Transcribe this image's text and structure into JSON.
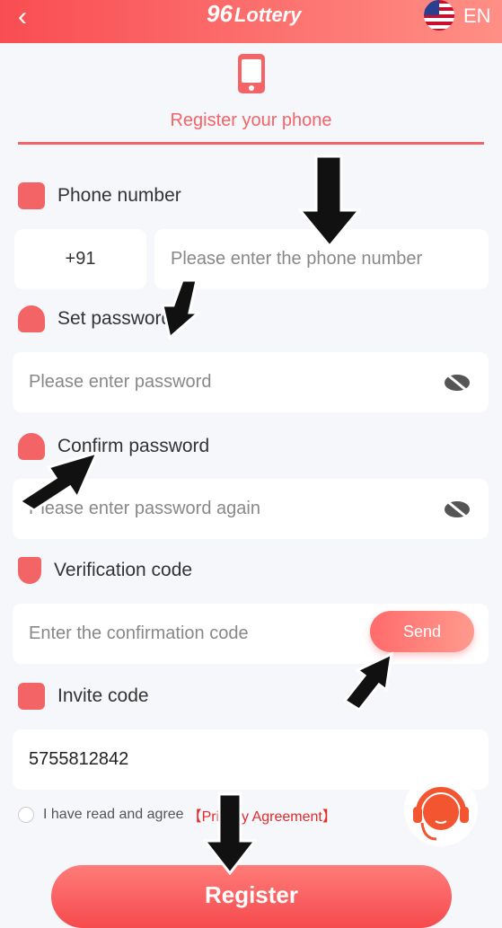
{
  "header": {
    "back_icon": "chevron-left-icon",
    "logo_text": "Lottery",
    "logo_mark": "96",
    "language": "EN",
    "flag_icon": "us-flag-icon"
  },
  "tab": {
    "title": "Register your phone",
    "icon": "smartphone-icon"
  },
  "form": {
    "phone": {
      "label": "Phone number",
      "country_code": "+91",
      "placeholder": "Please enter the phone number"
    },
    "password": {
      "label": "Set password",
      "placeholder": "Please enter password"
    },
    "confirm": {
      "label": "Confirm password",
      "placeholder": "Please enter password again"
    },
    "verification": {
      "label": "Verification code",
      "placeholder": "Enter the confirmation code",
      "send_label": "Send"
    },
    "invite": {
      "label": "Invite code",
      "value": "5755812842"
    },
    "agree_text": "I have read and agree",
    "agreement_link": "【Privacy Agreement】",
    "register_label": "Register"
  },
  "colors": {
    "accent": "#f36467",
    "header_start": "#f94d52",
    "header_end": "#ff8f86"
  }
}
